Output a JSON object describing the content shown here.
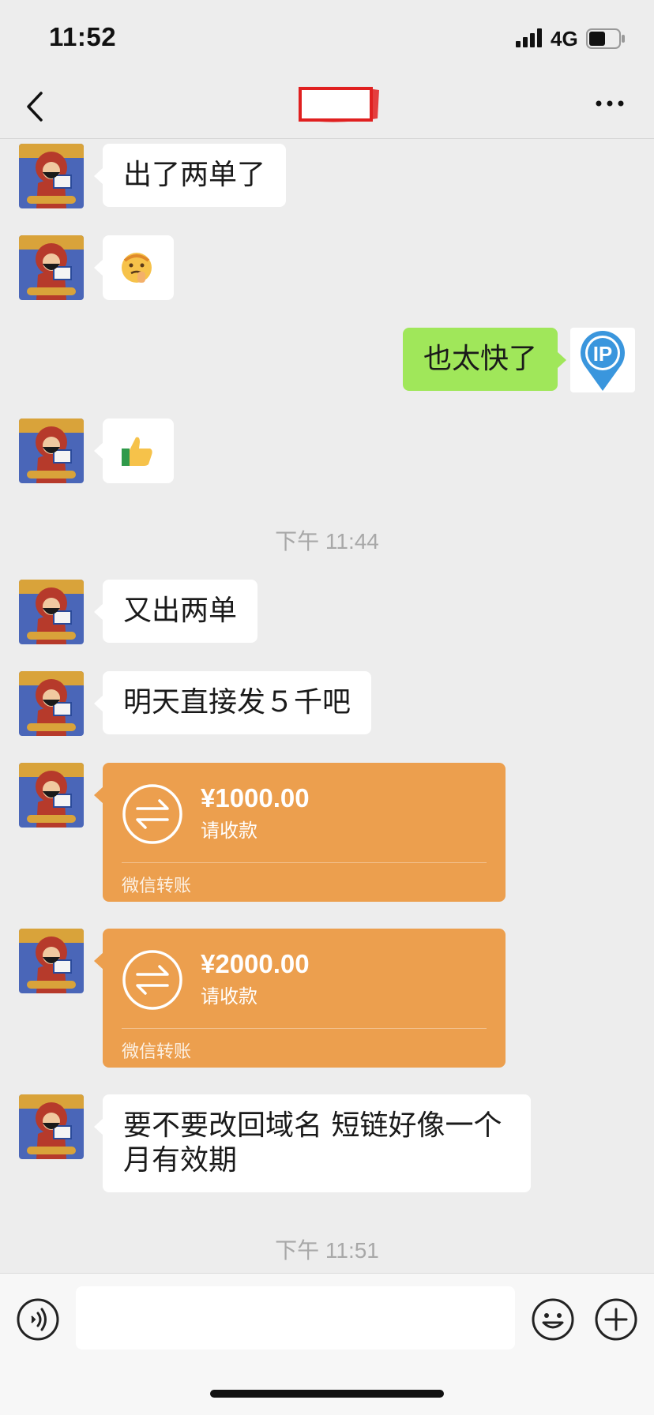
{
  "status_bar": {
    "time": "11:52",
    "network": "4G"
  },
  "nav": {
    "title": "",
    "back_icon": "chevron-left-icon",
    "more_icon": "more-dots-icon"
  },
  "messages": [
    {
      "side": "left",
      "type": "text",
      "text": "出了两单了"
    },
    {
      "side": "left",
      "type": "emoji",
      "emoji": "thinking-face-emoji"
    },
    {
      "side": "right",
      "type": "text",
      "text": "也太快了"
    },
    {
      "side": "left",
      "type": "emoji",
      "emoji": "thumbs-up-emoji"
    },
    {
      "type": "timestamp",
      "text": "下午 11:44"
    },
    {
      "side": "left",
      "type": "text",
      "text": "又出两单"
    },
    {
      "side": "left",
      "type": "text",
      "text": "明天直接发５千吧"
    },
    {
      "side": "left",
      "type": "transfer",
      "amount": "¥1000.00",
      "note": "请收款",
      "footer": "微信转账"
    },
    {
      "side": "left",
      "type": "transfer",
      "amount": "¥2000.00",
      "note": "请收款",
      "footer": "微信转账"
    },
    {
      "side": "left",
      "type": "text",
      "text": "要不要改回域名 短链好像一个月有效期"
    },
    {
      "type": "timestamp",
      "text": "下午 11:51"
    }
  ],
  "my_avatar": {
    "label": "IP",
    "color": "#3a96dd"
  },
  "input_bar": {
    "placeholder": "",
    "voice_icon": "voice-icon",
    "emoji_icon": "smiley-icon",
    "plus_icon": "plus-icon"
  },
  "colors": {
    "background": "#ededed",
    "my_bubble": "#a0e75a",
    "transfer": "#ec9f4e",
    "redaction": "#e02020"
  }
}
